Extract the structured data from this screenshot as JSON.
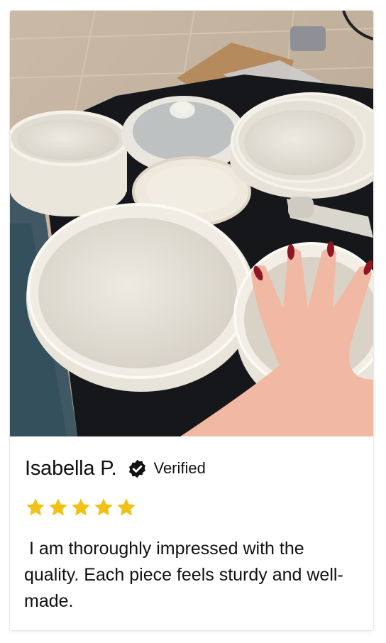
{
  "review": {
    "reviewer_name": "Isabella P.",
    "verified_label": "Verified",
    "verified_icon": "check-badge-icon",
    "rating": 5,
    "rating_max": 5,
    "star_icon": "star-icon",
    "star_color": "#F2C118",
    "text": " I am thoroughly impressed with the quality. Each piece feels sturdy and well-made."
  }
}
